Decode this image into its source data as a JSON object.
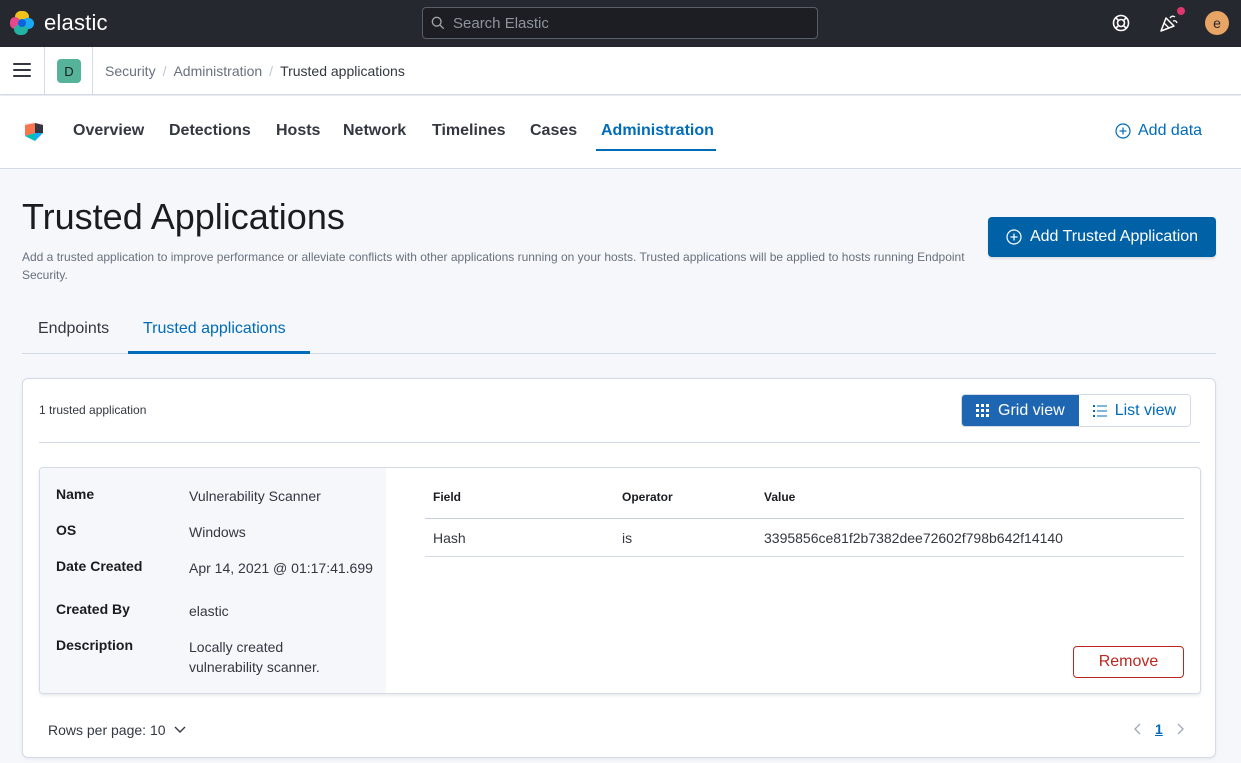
{
  "header": {
    "brand": "elastic",
    "search_placeholder": "Search Elastic",
    "avatar_initial": "e",
    "colors": {
      "bar": "#25282f",
      "avatar": "#e7a465",
      "notification": "#e0356e"
    }
  },
  "breadcrumbs": {
    "space_initial": "D",
    "items": [
      "Security",
      "Administration",
      "Trusted applications"
    ],
    "separator": "/"
  },
  "nav": {
    "tabs": [
      "Overview",
      "Detections",
      "Hosts",
      "Network",
      "Timelines",
      "Cases",
      "Administration"
    ],
    "active_tab": "Administration",
    "add_data": "Add data"
  },
  "page": {
    "title": "Trusted Applications",
    "description": "Add a trusted application to improve performance or alleviate conflicts with other applications running on your hosts. Trusted applications will be applied to hosts running Endpoint Security.",
    "primary_action": "Add Trusted Application"
  },
  "tabs": {
    "items": [
      "Endpoints",
      "Trusted applications"
    ],
    "active": "Trusted applications"
  },
  "list": {
    "count_text": "1 trusted application",
    "view_toggle": {
      "grid": "Grid view",
      "list": "List view",
      "selected": "Grid view"
    },
    "card": {
      "details": [
        {
          "label": "Name",
          "value": "Vulnerability Scanner"
        },
        {
          "label": "OS",
          "value": "Windows"
        },
        {
          "label": "Date Created",
          "value": "Apr 14, 2021 @ 01:17:41.699"
        },
        {
          "label": "Created By",
          "value": "elastic"
        },
        {
          "label": "Description",
          "value": "Locally created vulnerability scanner."
        }
      ],
      "conditions": {
        "columns": [
          "Field",
          "Operator",
          "Value"
        ],
        "rows": [
          {
            "field": "Hash",
            "operator": "is",
            "value": "3395856ce81f2b7382dee72602f798b642f14140"
          }
        ]
      },
      "remove_label": "Remove"
    },
    "pagination": {
      "rows_per_page": "Rows per page: 10",
      "current_page": "1"
    }
  },
  "accent_color": "#006bb8",
  "danger_color": "#bd271e"
}
